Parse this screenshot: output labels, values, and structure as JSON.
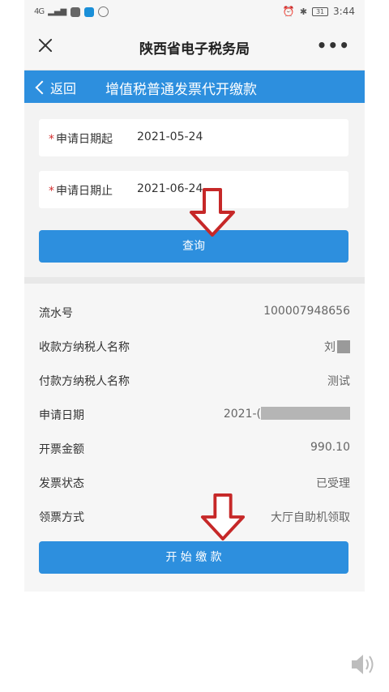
{
  "status_bar": {
    "signal": "4G",
    "time": "3:44",
    "battery": "31"
  },
  "title_bar": {
    "title": "陕西省电子税务局",
    "more": "•••"
  },
  "nav": {
    "back_label": "返回",
    "title": "增值税普通发票代开缴款"
  },
  "form": {
    "start_date": {
      "required_mark": "*",
      "label": "申请日期起",
      "value": "2021-05-24"
    },
    "end_date": {
      "required_mark": "*",
      "label": "申请日期止",
      "value": "2021-06-24"
    },
    "query_button": "查询"
  },
  "details": [
    {
      "key": "流水号",
      "value": "100007948656"
    },
    {
      "key": "收款方纳税人名称",
      "value": "刘"
    },
    {
      "key": "付款方纳税人名称",
      "value": "测试"
    },
    {
      "key": "申请日期",
      "value": "2021-("
    },
    {
      "key": "开票金额",
      "value": "990.10"
    },
    {
      "key": "发票状态",
      "value": "已受理"
    },
    {
      "key": "领票方式",
      "value": "大厅自助机领取"
    }
  ],
  "pay_button": "开 始 缴 款",
  "colors": {
    "primary": "#2d8fde",
    "required": "#d32f2f",
    "arrow": "#c62828"
  }
}
